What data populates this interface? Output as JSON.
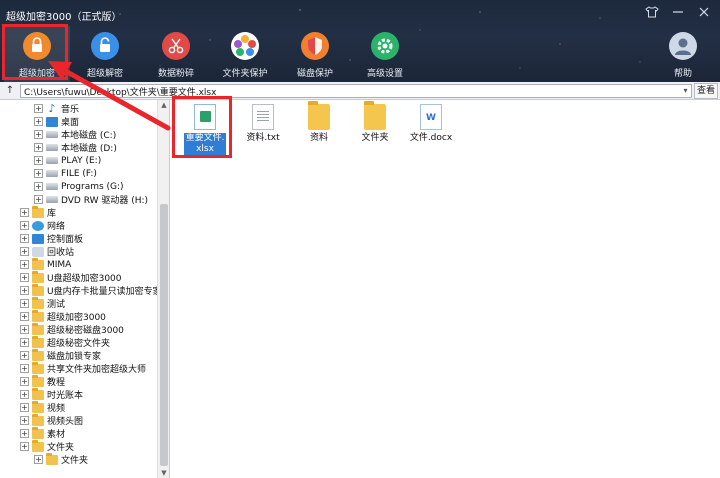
{
  "window": {
    "title": "超级加密3000（正式版）",
    "controls": [
      "shirt-icon",
      "minimize-icon",
      "close-icon"
    ]
  },
  "toolbar": {
    "items": [
      {
        "label": "超级加密",
        "icon": "lock-icon",
        "color": "#f08a2c"
      },
      {
        "label": "超级解密",
        "icon": "unlock-icon",
        "color": "#3a8fe8"
      },
      {
        "label": "数据粉碎",
        "icon": "scissors-icon",
        "color": "#e04b48"
      },
      {
        "label": "文件夹保护",
        "icon": "flower-icon",
        "color": "#f3b233"
      },
      {
        "label": "磁盘保护",
        "icon": "shield-icon",
        "color": "#f0802f"
      },
      {
        "label": "高级设置",
        "icon": "gear-icon",
        "color": "#2bb36a"
      },
      {
        "label": "帮助",
        "icon": "user-help-icon",
        "color": "#5b88c8"
      }
    ]
  },
  "address": {
    "path": "C:\\Users\\fuwu\\Desktop\\文件夹\\重要文件.xlsx",
    "view_label": "查看"
  },
  "tree": {
    "items": [
      {
        "label": "音乐",
        "icon": "music",
        "level": 2
      },
      {
        "label": "桌面",
        "icon": "blue",
        "level": 2
      },
      {
        "label": "本地磁盘 (C:)",
        "icon": "drive",
        "level": 2
      },
      {
        "label": "本地磁盘 (D:)",
        "icon": "drive",
        "level": 2
      },
      {
        "label": "PLAY (E:)",
        "icon": "drive",
        "level": 2
      },
      {
        "label": "FILE (F:)",
        "icon": "drive",
        "level": 2
      },
      {
        "label": "Programs (G:)",
        "icon": "drive",
        "level": 2
      },
      {
        "label": "DVD RW 驱动器 (H:)",
        "icon": "drive",
        "level": 2
      },
      {
        "label": "库",
        "icon": "folder",
        "level": 1
      },
      {
        "label": "网络",
        "icon": "net",
        "level": 1
      },
      {
        "label": "控制面板",
        "icon": "blue",
        "level": 1
      },
      {
        "label": "回收站",
        "icon": "recycle",
        "level": 1
      },
      {
        "label": "MIMA",
        "icon": "folder",
        "level": 1
      },
      {
        "label": "U盘超级加密3000",
        "icon": "folder",
        "level": 1
      },
      {
        "label": "U盘内存卡批量只读加密专家",
        "icon": "folder",
        "level": 1
      },
      {
        "label": "测试",
        "icon": "folder",
        "level": 1
      },
      {
        "label": "超级加密3000",
        "icon": "folder",
        "level": 1
      },
      {
        "label": "超级秘密磁盘3000",
        "icon": "folder",
        "level": 1
      },
      {
        "label": "超级秘密文件夹",
        "icon": "folder",
        "level": 1
      },
      {
        "label": "磁盘加锁专家",
        "icon": "folder",
        "level": 1
      },
      {
        "label": "共享文件夹加密超级大师",
        "icon": "folder",
        "level": 1
      },
      {
        "label": "教程",
        "icon": "folder",
        "level": 1
      },
      {
        "label": "时光账本",
        "icon": "folder",
        "level": 1
      },
      {
        "label": "视频",
        "icon": "folder",
        "level": 1
      },
      {
        "label": "视频头图",
        "icon": "folder",
        "level": 1
      },
      {
        "label": "素材",
        "icon": "folder",
        "level": 1
      },
      {
        "label": "文件夹",
        "icon": "folder",
        "level": 1
      },
      {
        "label": "文件夹",
        "icon": "folder",
        "level": 2
      }
    ]
  },
  "files": {
    "items": [
      {
        "name_line1": "重要文件.",
        "name_line2": "xlsx",
        "icon": "xlsx",
        "selected": true
      },
      {
        "name_line1": "资料.txt",
        "name_line2": "",
        "icon": "txt",
        "selected": false
      },
      {
        "name_line1": "资料",
        "name_line2": "",
        "icon": "folder",
        "selected": false
      },
      {
        "name_line1": "文件夹",
        "name_line2": "",
        "icon": "folder",
        "selected": false
      },
      {
        "name_line1": "文件.docx",
        "name_line2": "",
        "icon": "docx",
        "selected": false
      }
    ]
  }
}
